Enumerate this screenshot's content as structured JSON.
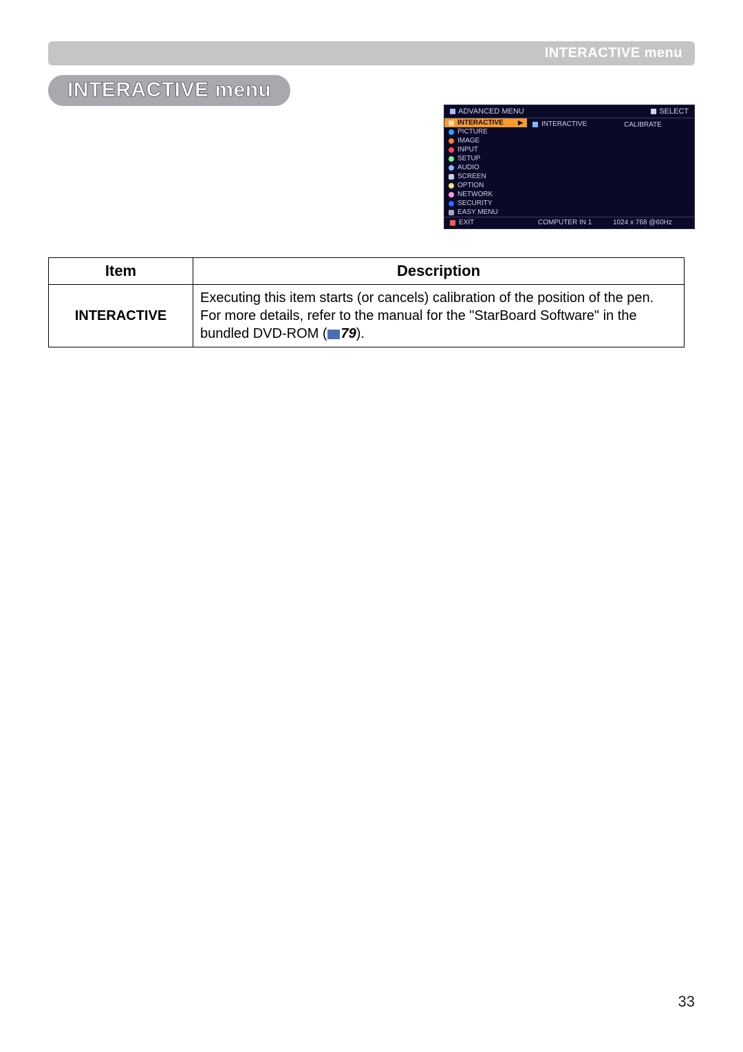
{
  "header": {
    "title": "INTERACTIVE menu"
  },
  "section_title": "INTERACTIVE menu",
  "osd": {
    "top_left": "ADVANCED MENU",
    "top_right_icon_label": "SELECT",
    "left_items": [
      {
        "label": "INTERACTIVE",
        "icon_color": "#f59a2e",
        "selected": true
      },
      {
        "label": "PICTURE",
        "icon_color": "#2aa5ff"
      },
      {
        "label": "IMAGE",
        "icon_color": "#ff7f2a"
      },
      {
        "label": "INPUT",
        "icon_color": "#ff4a4a"
      },
      {
        "label": "SETUP",
        "icon_color": "#7ef08a"
      },
      {
        "label": "AUDIO",
        "icon_color": "#7fb6ff"
      },
      {
        "label": "SCREEN",
        "icon_color": "#cfcfe0"
      },
      {
        "label": "OPTION",
        "icon_color": "#f5e27a"
      },
      {
        "label": "NETWORK",
        "icon_color": "#ff9ad4"
      },
      {
        "label": "SECURITY",
        "icon_color": "#2a6aff"
      },
      {
        "label": "EASY MENU",
        "icon_color": "#a8a8c0"
      }
    ],
    "mid_item": "INTERACTIVE",
    "right_item": "CALIBRATE",
    "footer_left": "EXIT",
    "footer_mid": "COMPUTER IN 1",
    "footer_right": "1024 x 768 @60Hz"
  },
  "table": {
    "headers": {
      "item": "Item",
      "description": "Description"
    },
    "rows": [
      {
        "item": "INTERACTIVE",
        "desc_line1": "Executing this item starts (or cancels) calibration of the position of the pen.",
        "desc_line2_prefix": "For more details, refer to the manual for the \"StarBoard Software\" in the bundled DVD-ROM (",
        "desc_ref": "79",
        "desc_line2_suffix": ")."
      }
    ]
  },
  "page_number": "33"
}
